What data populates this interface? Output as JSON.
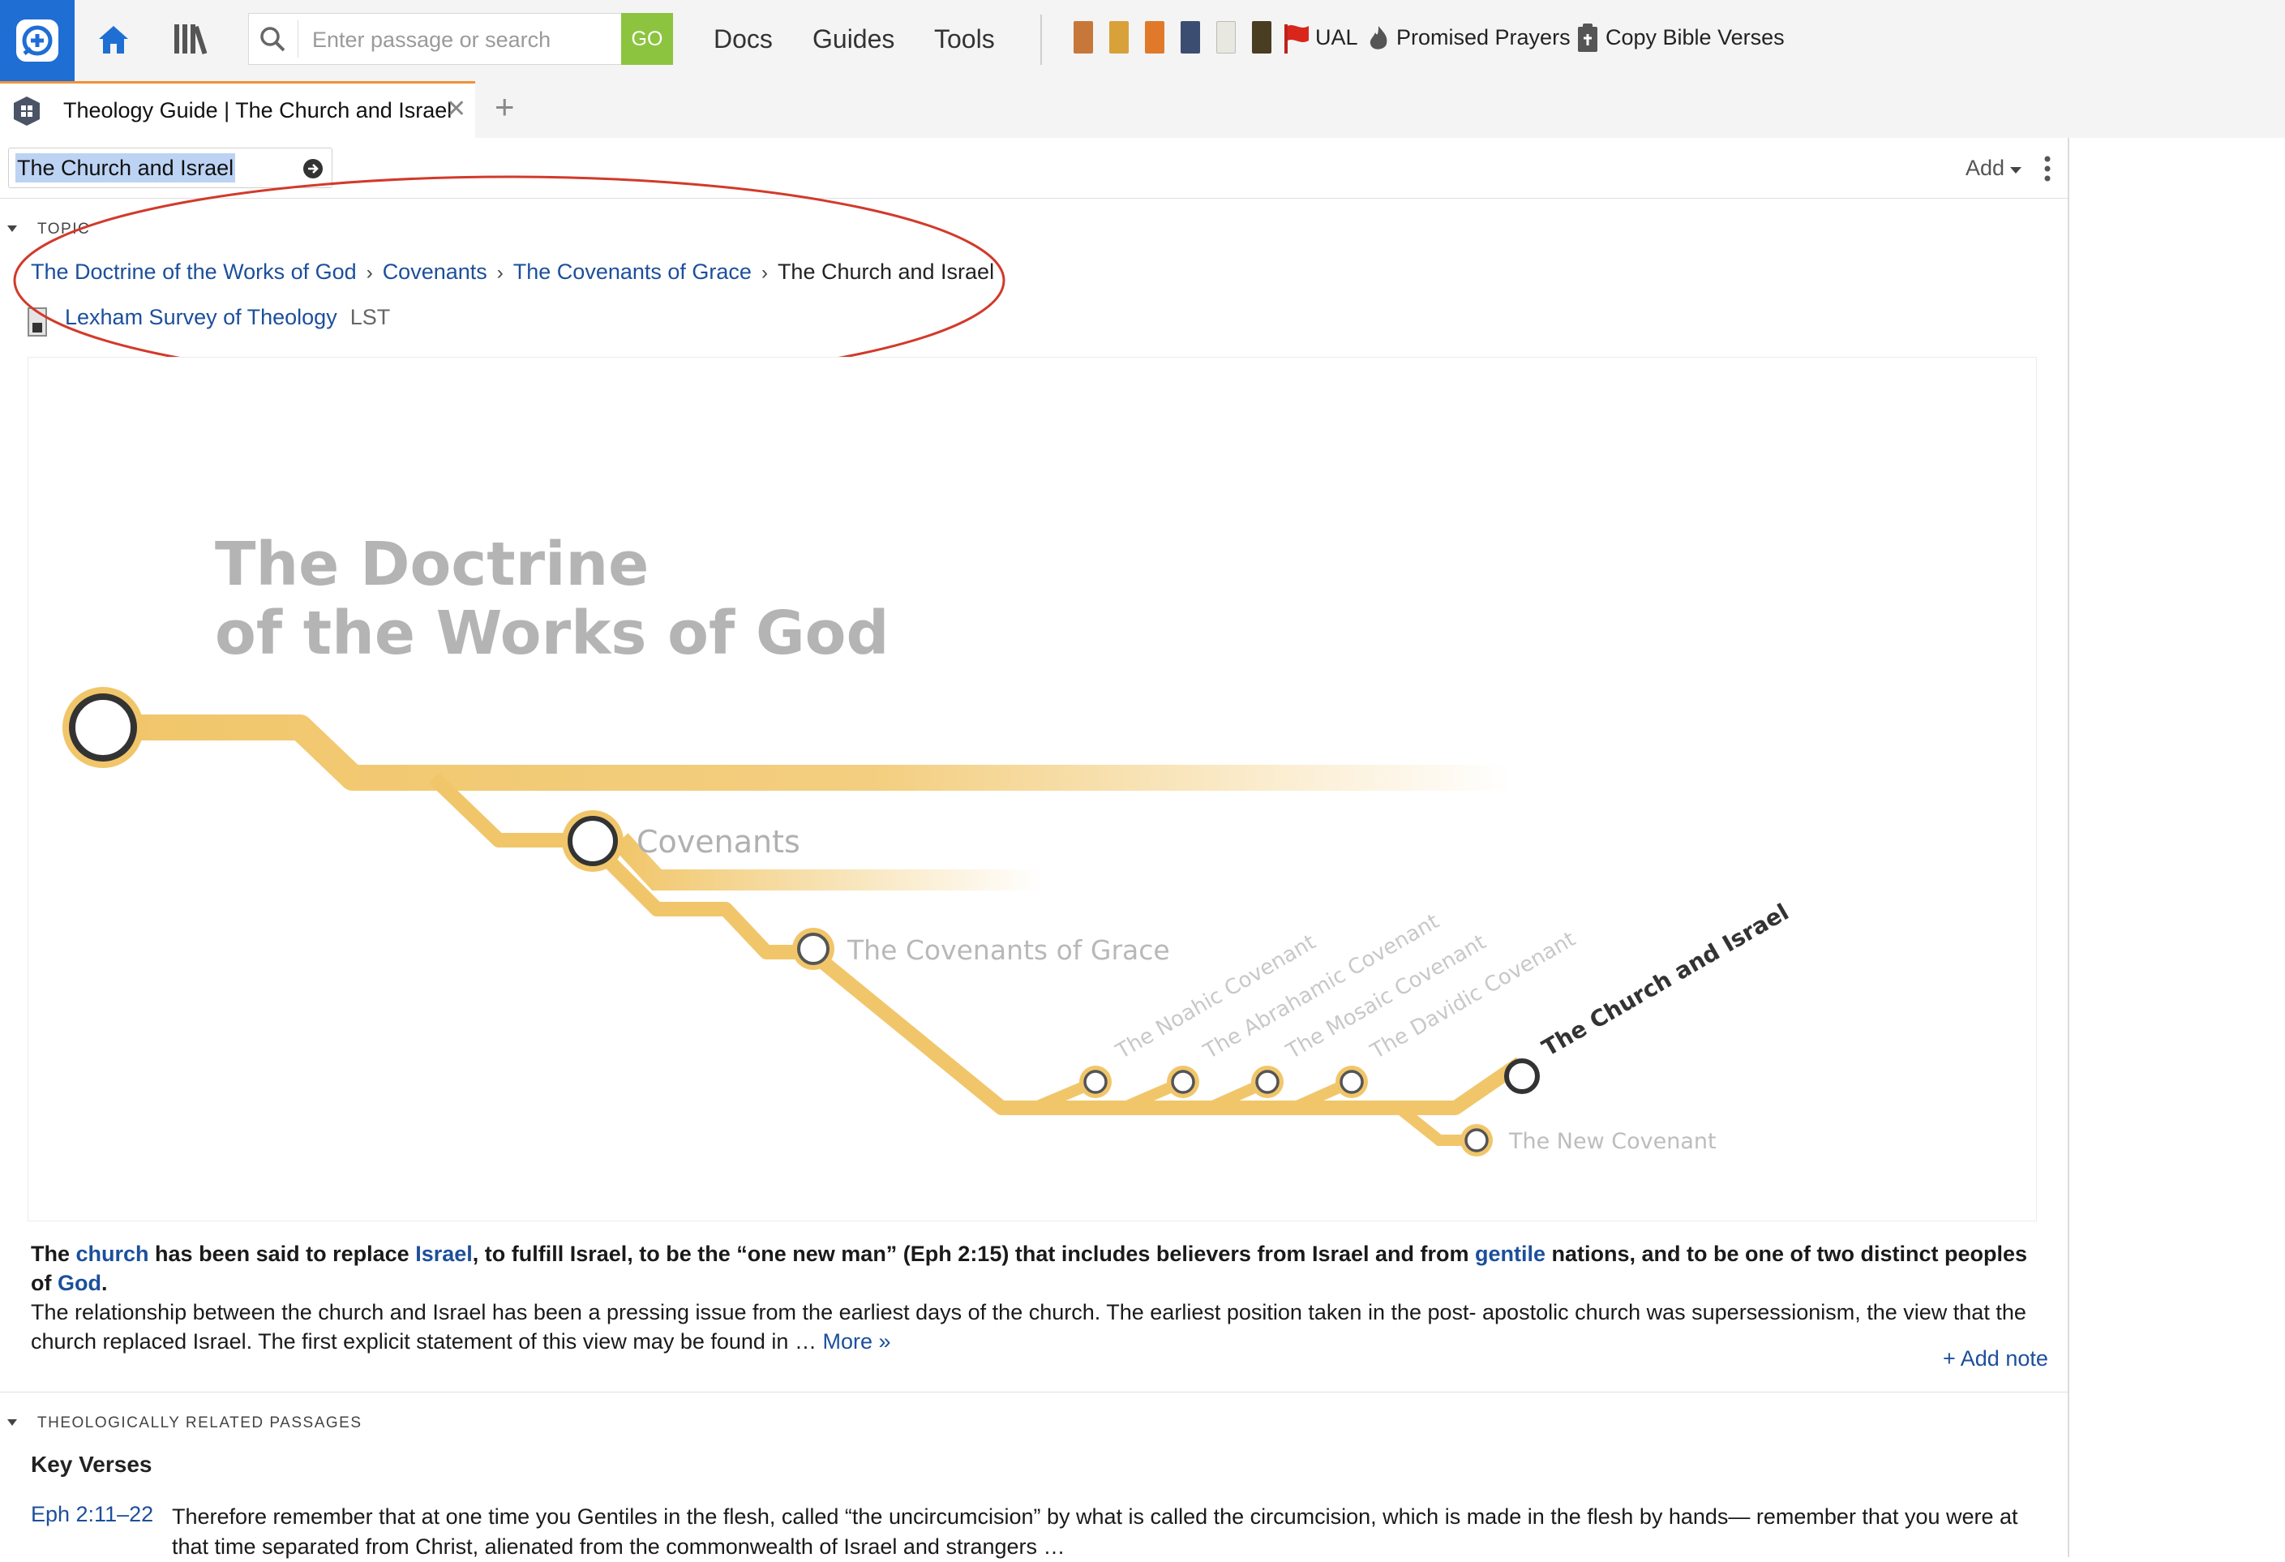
{
  "toolbar": {
    "search_placeholder": "Enter passage or search",
    "go_label": "GO",
    "menu": [
      "Docs",
      "Guides",
      "Tools"
    ],
    "shortcuts": {
      "ual": "UAL",
      "promised_prayers": "Promised Prayers",
      "copy_bible_verses": "Copy Bible Verses"
    },
    "colors": {
      "brand": "#1f6ed4",
      "go": "#8cc43f",
      "tab_accent": "#f0923a"
    }
  },
  "tab": {
    "title": "Theology Guide | The Church and Israel",
    "close_glyph": "✕",
    "add_glyph": "+"
  },
  "panel": {
    "reference": "The Church and Israel",
    "add_label": "Add"
  },
  "topic": {
    "section_label": "TOPIC",
    "breadcrumbs": [
      "The Doctrine of the Works of God",
      "Covenants",
      "The Covenants of Grace"
    ],
    "current": "The Church and Israel",
    "source_title": "Lexham Survey of Theology",
    "source_abbr": "LST"
  },
  "diagram": {
    "title_line1": "The Doctrine",
    "title_line2": "of the Works of God",
    "labels": {
      "covenants": "Covenants",
      "covenants_of_grace": "The Covenants of Grace",
      "noahic": "The Noahic Covenant",
      "abrahamic": "The Abrahamic Covenant",
      "mosaic": "The Mosaic Covenant",
      "davidic": "The Davidic Covenant",
      "church_israel": "The Church and Israel",
      "new_covenant": "The New Covenant"
    },
    "line_color": "#f1c66a"
  },
  "summary": {
    "w1": "The ",
    "church": "church",
    "w2": " has been said to replace ",
    "israel": "Israel",
    "w3": ", to fulfill Israel, to be the “one new man” (Eph 2:15) that includes believers from Israel and from ",
    "gentile": "gentile",
    "w4": " nations, and to be one of two distinct peoples of ",
    "god": "God",
    "w5": ".",
    "body": "The relationship between the church and Israel has been a pressing issue from the earliest days of the church. The earliest position taken in the post- apostolic church was supersessionism, the view that the church replaced Israel. The first explicit statement of this view may be found in … ",
    "more": "More »",
    "add_note": "+ Add note"
  },
  "passages": {
    "section_label": "THEOLOGICALLY RELATED PASSAGES",
    "key_verses_heading": "Key Verses",
    "items": [
      {
        "ref": "Eph 2:11–22",
        "text": "Therefore remember that at one time you Gentiles in the flesh, called “the uncircumcision” by what is called the circumcision, which is made in the flesh by hands— remember that you were at that time separated from Christ, alienated from the commonwealth of Israel and strangers …"
      }
    ]
  }
}
